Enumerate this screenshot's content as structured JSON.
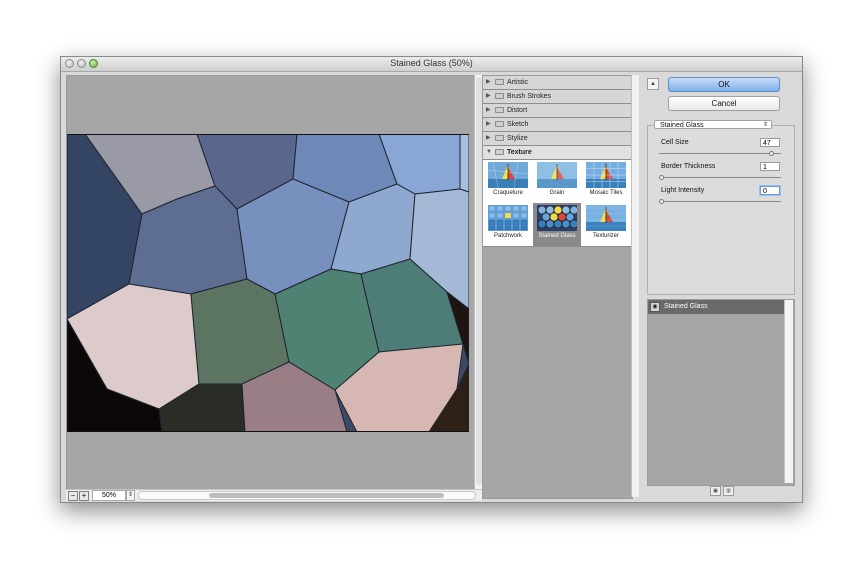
{
  "window": {
    "title": "Stained Glass (50%)"
  },
  "preview": {
    "zoom": "50%",
    "zoom_out_icon": "minus-icon",
    "zoom_in_icon": "plus-icon"
  },
  "gallery": {
    "categories": [
      "Artistic",
      "Brush Strokes",
      "Distort",
      "Sketch",
      "Stylize"
    ],
    "open_category": "Texture",
    "filters": [
      "Craquelure",
      "Grain",
      "Mosaic Tiles",
      "Patchwork",
      "Stained Glass",
      "Texturizer"
    ],
    "selected": "Stained Glass"
  },
  "buttons": {
    "ok": "OK",
    "cancel": "Cancel",
    "collapse_icon": "chevron-up-icon"
  },
  "settings": {
    "filter_select": "Stained Glass",
    "cell_size": {
      "label": "Cell Size",
      "value": "47",
      "slider_fraction": 0.94
    },
    "border_thickness": {
      "label": "Border Thickness",
      "value": "1",
      "slider_fraction": 0.0
    },
    "light_intensity": {
      "label": "Light Intensity",
      "value": "0",
      "slider_fraction": 0.0
    }
  },
  "layers": {
    "items": [
      "Stained Glass"
    ]
  },
  "colors": {
    "accent": "#7fb1ea",
    "selected_thumb": "#898989",
    "panel": "#a6a6a6"
  }
}
